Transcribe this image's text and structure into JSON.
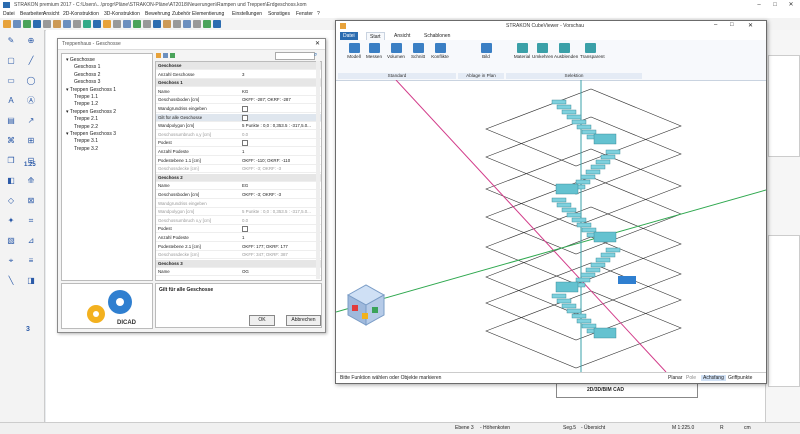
{
  "app": {
    "title": "STRAKON premium 2017 - C:\\Users\\...\\progr\\Pläne\\STRAKON-Pläne\\AT2018\\Neuerungen\\Rampen und Treppen\\Erdgeschoss.kom",
    "colors": {
      "accent": "#2b6cb0",
      "stair": "#7fd1de",
      "axis_green": "#2fa84f",
      "axis_red": "#d23c8a",
      "axis_teal": "#3aa0a8"
    }
  },
  "menu": [
    "Datei",
    "Bearbeiten",
    "Ansicht",
    "2D-Konstruktion",
    "3D-Konstruktion",
    "Bewehrung",
    "Zubehör",
    "Elementierung",
    "Einstellungen",
    "Sonstiges",
    "Fenster",
    "?"
  ],
  "dialog": {
    "title": "Treppenhaus - Geschosse",
    "tree": [
      {
        "label": "Geschosse",
        "level": 0
      },
      {
        "label": "Geschoss 1",
        "level": 1
      },
      {
        "label": "Geschoss 2",
        "level": 1
      },
      {
        "label": "Geschoss 3",
        "level": 1
      },
      {
        "label": "Treppen Geschoss 1",
        "level": 0
      },
      {
        "label": "Treppe 1.1",
        "level": 1
      },
      {
        "label": "Treppe 1.2",
        "level": 1
      },
      {
        "label": "Treppen Geschoss 2",
        "level": 0
      },
      {
        "label": "Treppe 2.1",
        "level": 1
      },
      {
        "label": "Treppe 2.2",
        "level": 1
      },
      {
        "label": "Treppen Geschoss 3",
        "level": 0
      },
      {
        "label": "Treppe 3.1",
        "level": 1
      },
      {
        "label": "Treppe 3.2",
        "level": 1
      }
    ],
    "properties": [
      {
        "k": "Geschosse",
        "v": "",
        "type": "section"
      },
      {
        "k": "Anzahl Geschosse",
        "v": "3"
      },
      {
        "k": "Geschoss 1",
        "v": "",
        "type": "section"
      },
      {
        "k": "Name",
        "v": "KG"
      },
      {
        "k": "Geschossboden [cm]",
        "v": "OKFF: -287; OKRF: -287"
      },
      {
        "k": "Wandgrundriss eingeben",
        "v": "",
        "type": "check"
      },
      {
        "k": "Gilt für alle Geschosse",
        "v": "",
        "type": "check",
        "highlight": true
      },
      {
        "k": "Wandpolygon [cm]",
        "v": "5 Punkte : 0,0 : 0,353.5 : -317,5.0..."
      },
      {
        "k": "Geschossumbruch x,y [cm]",
        "v": "0.0",
        "type": "dim"
      },
      {
        "k": "Podest",
        "v": "",
        "type": "check"
      },
      {
        "k": "Anzahl Podeste",
        "v": "1"
      },
      {
        "k": "Podestebene 1.1 [cm]",
        "v": "OKFF: -110; OKRF: -110"
      },
      {
        "k": "Geschossdecke [cm]",
        "v": "OKFF: -3; OKRF: -3",
        "type": "dim"
      },
      {
        "k": "Geschoss 2",
        "v": "",
        "type": "section"
      },
      {
        "k": "Name",
        "v": "EG"
      },
      {
        "k": "Geschossboden [cm]",
        "v": "OKFF: -3; OKRF: -3"
      },
      {
        "k": "Wandgrundriss eingeben",
        "v": "",
        "type": "dim"
      },
      {
        "k": "Wandpolygon [cm]",
        "v": "5 Punkte : 0,0 : 0,353.5 : -317,5.0...",
        "type": "dim"
      },
      {
        "k": "Geschossumbruch x,y [cm]",
        "v": "0.0",
        "type": "dim"
      },
      {
        "k": "Podest",
        "v": "",
        "type": "check"
      },
      {
        "k": "Anzahl Podeste",
        "v": "1"
      },
      {
        "k": "Podestebene 2.1 [cm]",
        "v": "OKFF: 177; OKRF: 177"
      },
      {
        "k": "Geschossdecke [cm]",
        "v": "OKFF: 347; OKRF: 387",
        "type": "dim"
      },
      {
        "k": "Geschoss 3",
        "v": "",
        "type": "section"
      },
      {
        "k": "Name",
        "v": "OG"
      }
    ],
    "description": "Gilt für alle Geschosse",
    "ok_label": "OK",
    "cancel_label": "Abbrechen",
    "brand": "DICAD"
  },
  "viewer": {
    "title": "STRAKON CubeViewer - Vorschau",
    "tabs": [
      "Datei",
      "Start",
      "Ansicht",
      "Schablonen"
    ],
    "active_tab": "Start",
    "buttons": [
      {
        "label": "Modell",
        "group": "Standard",
        "icon": "model-icon"
      },
      {
        "label": "Messen",
        "group": "Standard",
        "icon": "measure-icon"
      },
      {
        "label": "Volumen",
        "group": "Standard",
        "icon": "volume-icon"
      },
      {
        "label": "Schnitt",
        "group": "Standard",
        "icon": "section-icon"
      },
      {
        "label": "Konflikte",
        "group": "Standard",
        "icon": "conflict-icon"
      },
      {
        "label": "Bild",
        "group": "Ablage in Plan",
        "icon": "image-icon"
      },
      {
        "label": "Material",
        "group": "Selektion",
        "icon": "material-icon"
      },
      {
        "label": "Umkehren",
        "group": "Selektion",
        "icon": "invert-icon"
      },
      {
        "label": "Ausblenden",
        "group": "Selektion",
        "icon": "hide-icon"
      },
      {
        "label": "Transparent",
        "group": "Selektion",
        "icon": "transparent-icon"
      }
    ],
    "groups": [
      "Standard",
      "Ablage in Plan",
      "Selektion"
    ],
    "status": "Bitte Funktion wählen oder Objekte markieren",
    "snap_modes": [
      "Planar",
      "Pole",
      "Achsfang",
      "Griffpunkte"
    ],
    "active_snap": "Achsfang"
  },
  "statusbar": [
    "Ebene 3",
    "- Höhenkoten",
    "Seg.5",
    "- Übersicht",
    "M 1:225.0",
    "R",
    "cm"
  ],
  "left_tools": [
    "3",
    "1.25"
  ],
  "plan_stamp": "2D/3D/BIM CAD"
}
